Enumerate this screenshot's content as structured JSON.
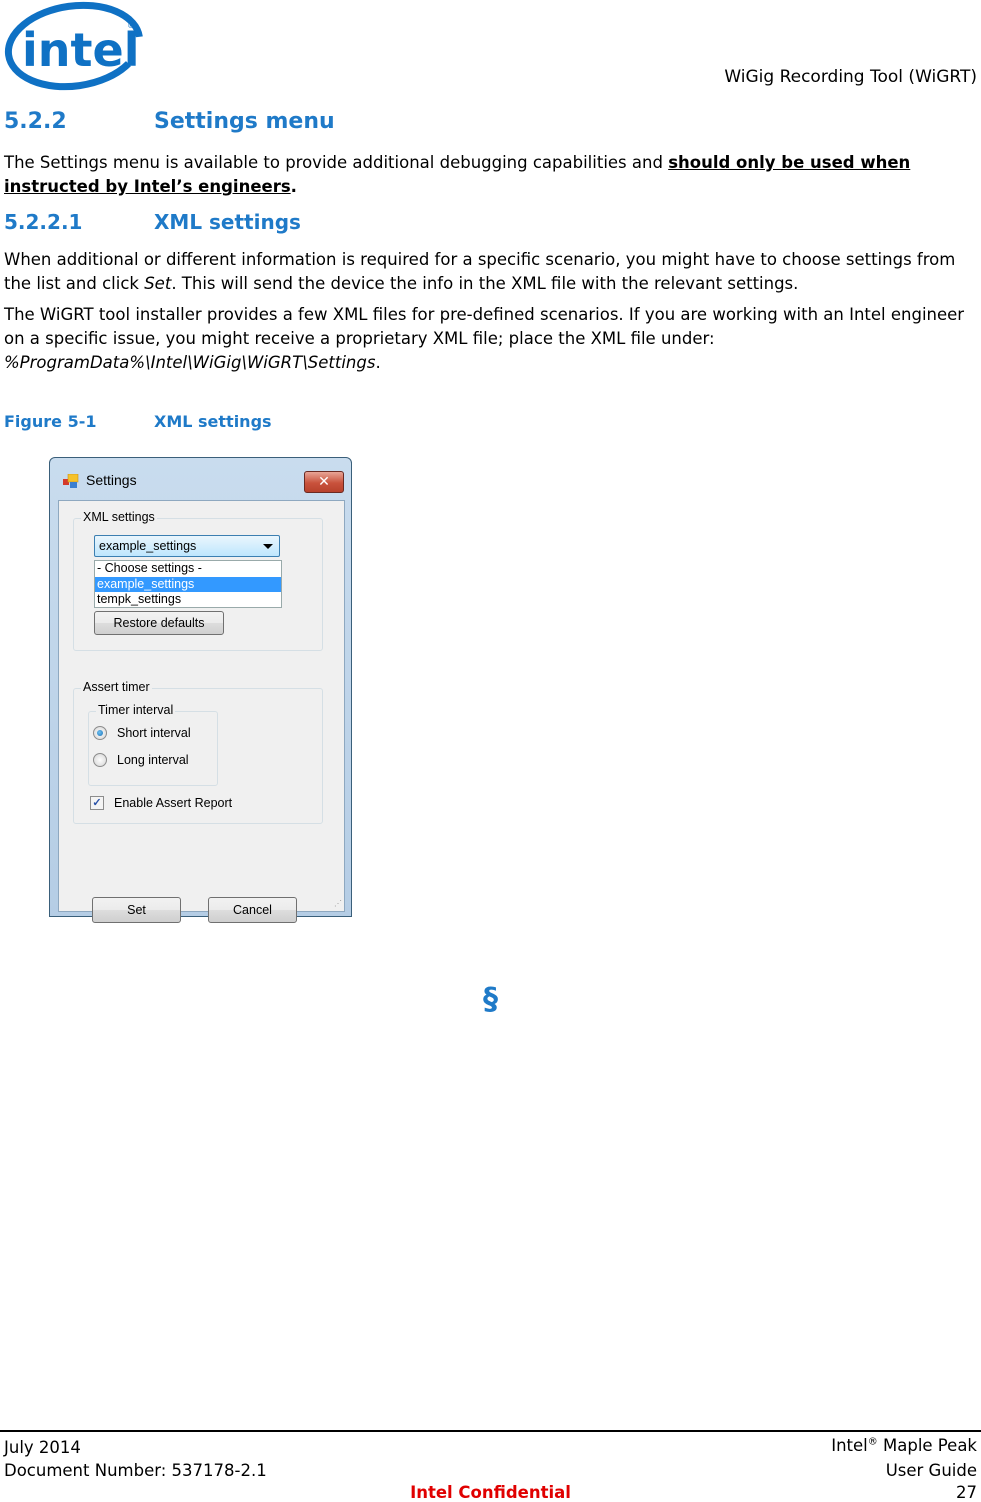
{
  "header": {
    "logo_text": "intel",
    "doc_title": "WiGig Recording Tool (WiGRT)"
  },
  "section": {
    "number": "5.2.2",
    "title": "Settings menu",
    "intro_prefix": "The Settings menu is available to provide additional debugging capabilities and ",
    "intro_emphasis": "should only be used when instructed by Intel’s engineers",
    "intro_suffix": "."
  },
  "subsection": {
    "number": "5.2.2.1",
    "title": "XML settings",
    "para1_a": "When additional or different information is required for a specific scenario, you might have to choose settings from the list and click ",
    "para1_italic": "Set",
    "para1_b": ". This will send the device the info in the XML file with the relevant settings.",
    "para2_a": "The WiGRT tool installer provides a few XML files for pre-defined scenarios. If you are working with an Intel engineer on a specific issue, you might receive a proprietary XML file; place the XML file under: ",
    "para2_italic": "%ProgramData%\\Intel\\WiGig\\WiGRT\\Settings",
    "para2_b": "."
  },
  "figure": {
    "number": "Figure 5-1",
    "caption": "XML settings"
  },
  "dialog": {
    "title": "Settings",
    "close_glyph": "✕",
    "xml_group_label": "XML settings",
    "combo_value": "example_settings",
    "dropdown_options": [
      "- Choose settings -",
      "example_settings",
      "tempk_settings"
    ],
    "dropdown_selected_index": 1,
    "restore_label": "Restore defaults",
    "assert_group_label": "Assert timer",
    "timer_group_label": "Timer interval",
    "radio_short": "Short interval",
    "radio_long": "Long interval",
    "radio_selected": "Short interval",
    "checkbox_label": "Enable Assert Report",
    "checkbox_checked": true,
    "check_glyph": "✓",
    "set_label": "Set",
    "cancel_label": "Cancel"
  },
  "section_end_mark": "§",
  "footer": {
    "date": "July 2014",
    "doc_number": "Document Number: 537178-2.1",
    "product_prefix": "Intel",
    "product_reg": "®",
    "product_suffix": " Maple Peak",
    "guide": "User Guide",
    "confidential": "Intel Confidential",
    "page": "27"
  },
  "colors": {
    "heading_blue": "#1f7ac8",
    "confidential_red": "#e00000",
    "intel_logo_blue": "#0f71c4"
  }
}
